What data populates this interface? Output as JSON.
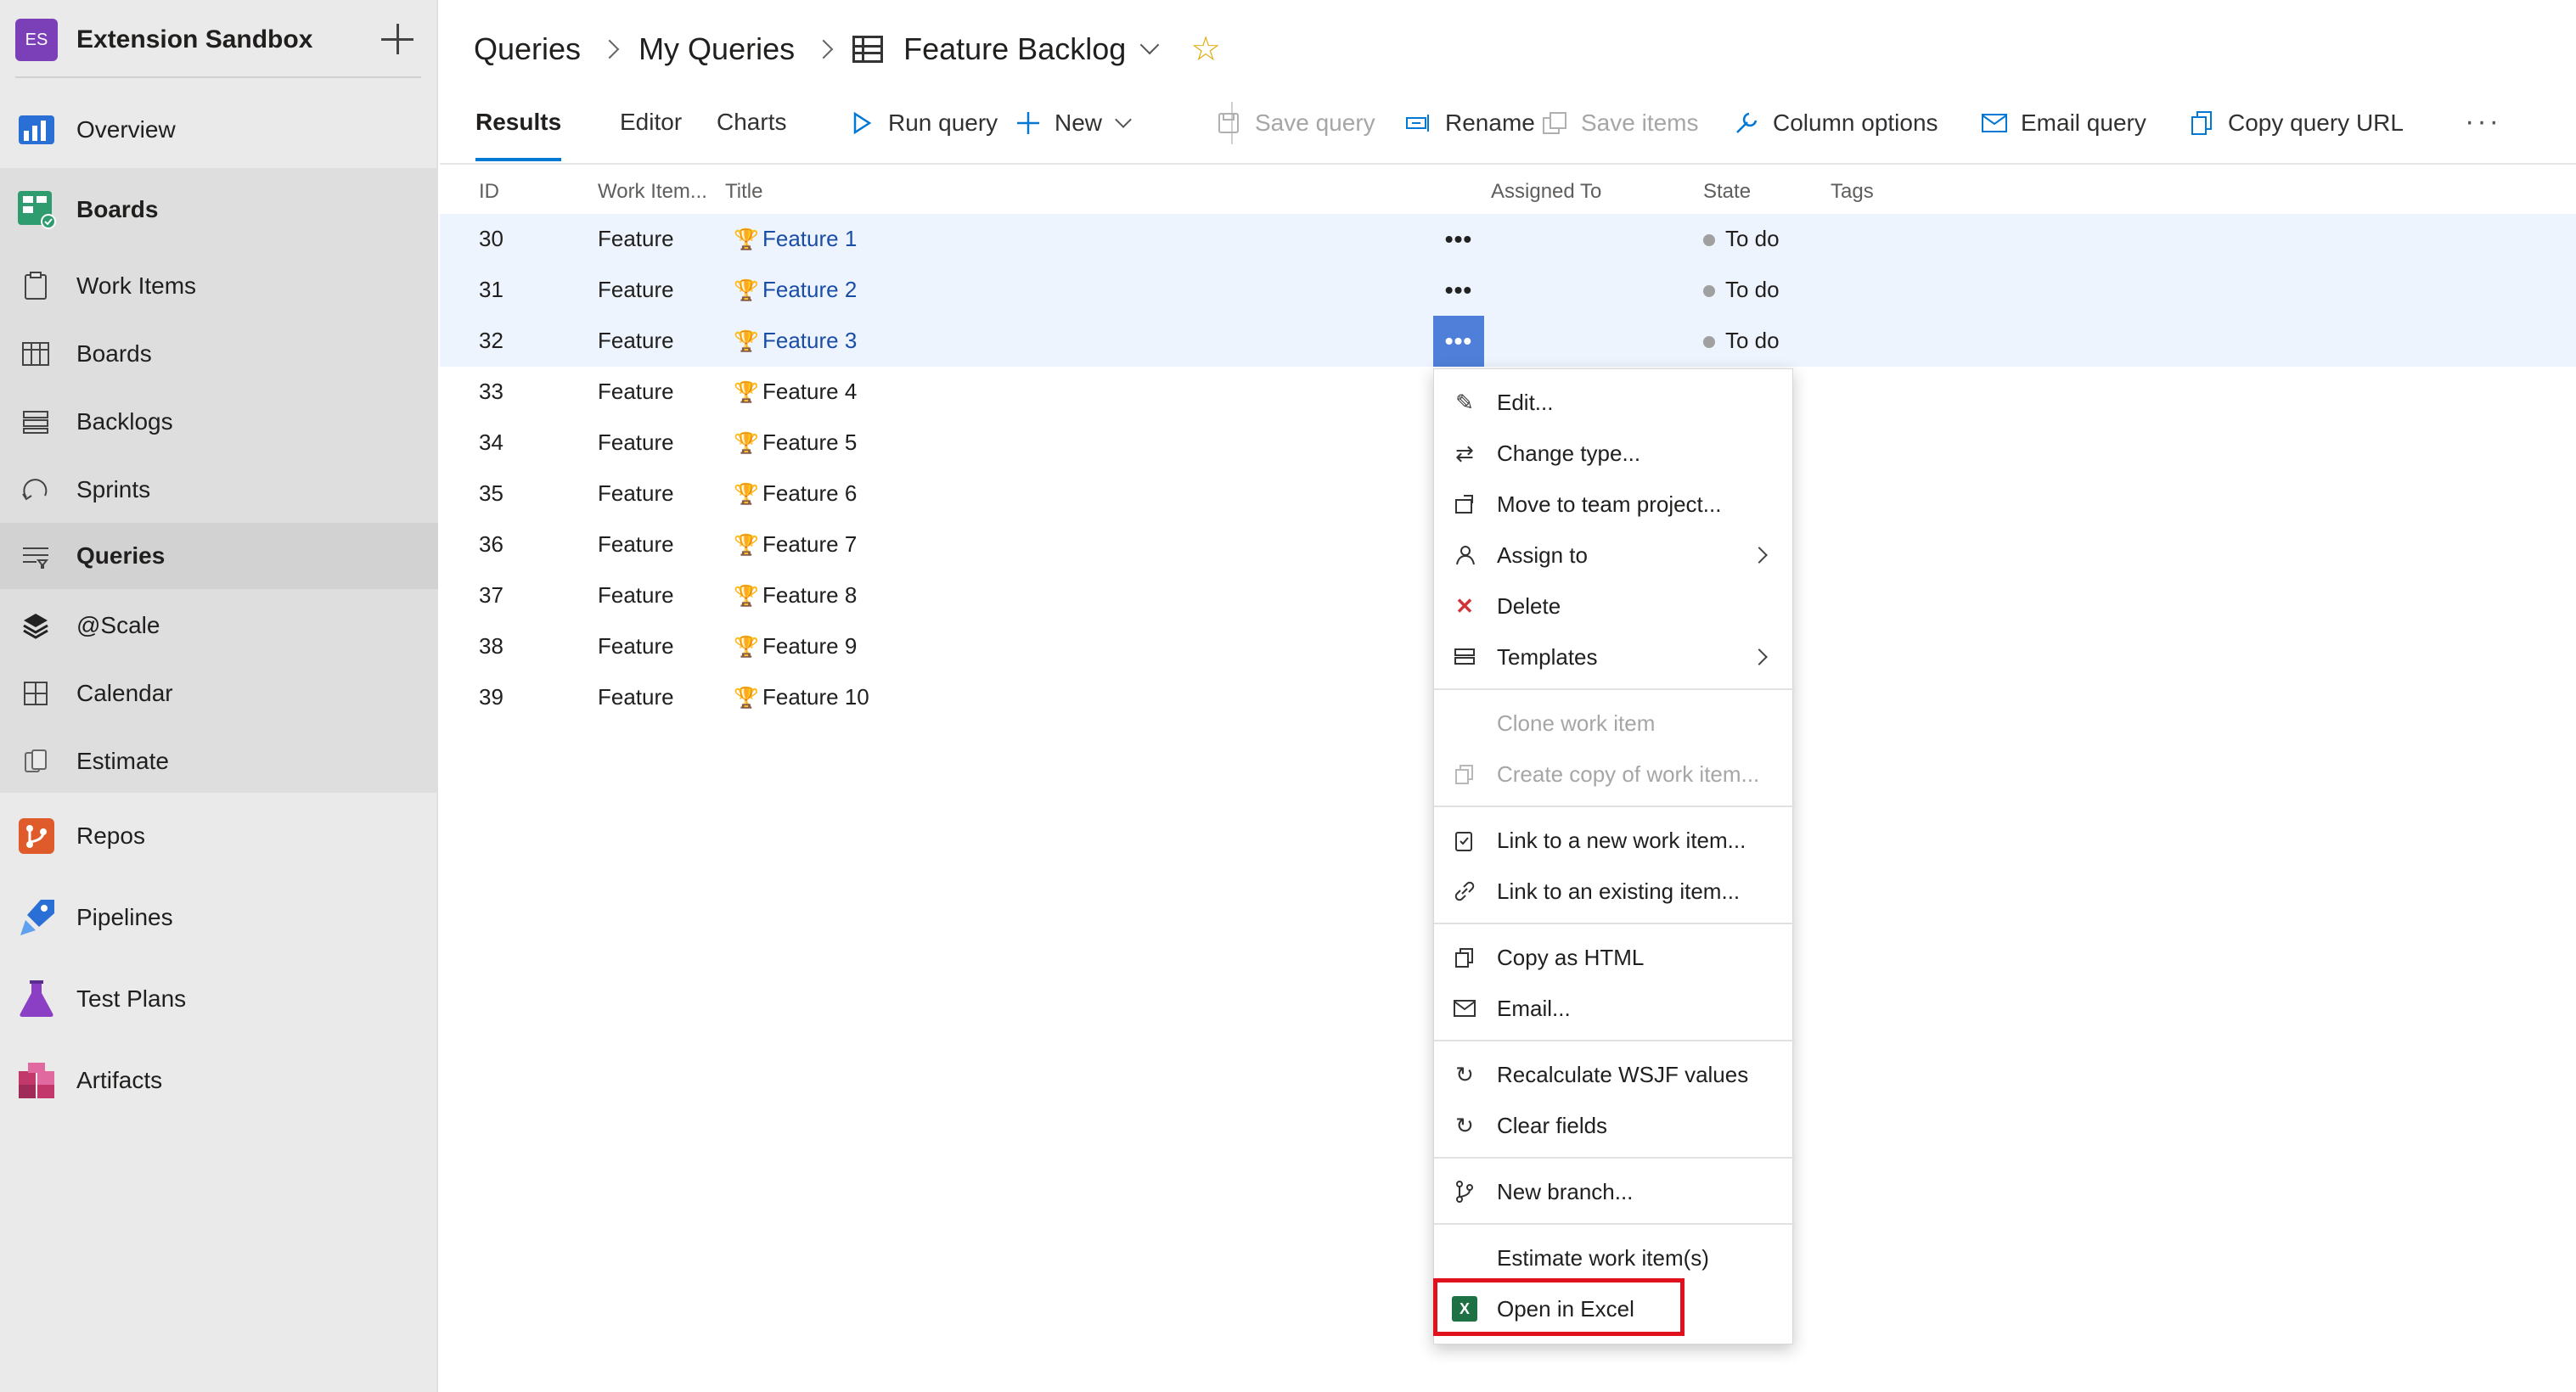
{
  "organization": {
    "initials": "ES",
    "name": "Extension Sandbox"
  },
  "sidebar": {
    "items": [
      {
        "label": "Overview",
        "icon": "overview-icon",
        "color": "#2a6fd6"
      },
      {
        "label": "Boards",
        "icon": "boards-hub-icon",
        "color": "#2e9c6e"
      },
      {
        "label": "Work Items",
        "icon": "work-items-icon"
      },
      {
        "label": "Boards",
        "icon": "kanban-icon"
      },
      {
        "label": "Backlogs",
        "icon": "backlogs-icon"
      },
      {
        "label": "Sprints",
        "icon": "sprints-icon"
      },
      {
        "label": "Queries",
        "icon": "queries-icon"
      },
      {
        "label": "@Scale",
        "icon": "scale-icon"
      },
      {
        "label": "Calendar",
        "icon": "calendar-icon"
      },
      {
        "label": "Estimate",
        "icon": "estimate-icon"
      },
      {
        "label": "Repos",
        "icon": "repos-icon",
        "color": "#e05b2b"
      },
      {
        "label": "Pipelines",
        "icon": "pipelines-icon",
        "color": "#2a6fd6"
      },
      {
        "label": "Test Plans",
        "icon": "test-plans-icon",
        "color": "#8a3fc4"
      },
      {
        "label": "Artifacts",
        "icon": "artifacts-icon",
        "color": "#c2386b"
      }
    ]
  },
  "breadcrumb": {
    "root": "Queries",
    "folder": "My Queries",
    "query": "Feature Backlog"
  },
  "tabs": [
    "Results",
    "Editor",
    "Charts"
  ],
  "commands": {
    "run": "Run query",
    "new": "New",
    "save": "Save query",
    "rename": "Rename",
    "save_items": "Save items",
    "column_options": "Column options",
    "email": "Email query",
    "copy_url": "Copy query URL"
  },
  "table": {
    "headers": [
      "ID",
      "Work Item...",
      "Title",
      "Assigned To",
      "State",
      "Tags"
    ],
    "rows": [
      {
        "id": "30",
        "type": "Feature",
        "title": "Feature 1",
        "state": "To do"
      },
      {
        "id": "31",
        "type": "Feature",
        "title": "Feature 2",
        "state": "To do"
      },
      {
        "id": "32",
        "type": "Feature",
        "title": "Feature 3",
        "state": "To do"
      },
      {
        "id": "33",
        "type": "Feature",
        "title": "Feature 4"
      },
      {
        "id": "34",
        "type": "Feature",
        "title": "Feature 5"
      },
      {
        "id": "35",
        "type": "Feature",
        "title": "Feature 6"
      },
      {
        "id": "36",
        "type": "Feature",
        "title": "Feature 7"
      },
      {
        "id": "37",
        "type": "Feature",
        "title": "Feature 8"
      },
      {
        "id": "38",
        "type": "Feature",
        "title": "Feature 9"
      },
      {
        "id": "39",
        "type": "Feature",
        "title": "Feature 10"
      }
    ]
  },
  "context_menu": {
    "items": [
      {
        "label": "Edit...",
        "icon": "pencil-icon"
      },
      {
        "label": "Change type...",
        "icon": "swap-icon"
      },
      {
        "label": "Move to team project...",
        "icon": "move-icon"
      },
      {
        "label": "Assign to",
        "icon": "assign-icon",
        "submenu": true
      },
      {
        "label": "Delete",
        "icon": "delete-icon",
        "color": "#d13438"
      },
      {
        "label": "Templates",
        "icon": "templates-icon",
        "submenu": true
      },
      {
        "label": "Clone work item",
        "disabled": true
      },
      {
        "label": "Create copy of work item...",
        "icon": "copy-icon",
        "disabled": true
      },
      {
        "label": "Link to a new work item...",
        "icon": "link-new-icon"
      },
      {
        "label": "Link to an existing item...",
        "icon": "link-icon"
      },
      {
        "label": "Copy as HTML",
        "icon": "copy-html-icon"
      },
      {
        "label": "Email...",
        "icon": "mail-icon"
      },
      {
        "label": "Recalculate WSJF values",
        "icon": "refresh-icon"
      },
      {
        "label": "Clear fields",
        "icon": "refresh-icon"
      },
      {
        "label": "New branch...",
        "icon": "branch-icon"
      },
      {
        "label": "Estimate work item(s)"
      },
      {
        "label": "Open in Excel",
        "icon": "excel-icon",
        "highlighted": true
      }
    ],
    "highlight_color": "#e0101c"
  },
  "colors": {
    "accent": "#0078d4",
    "link": "#1a4ea6",
    "selected_row": "#eef4fd",
    "pressed": "#4f7fd8"
  }
}
